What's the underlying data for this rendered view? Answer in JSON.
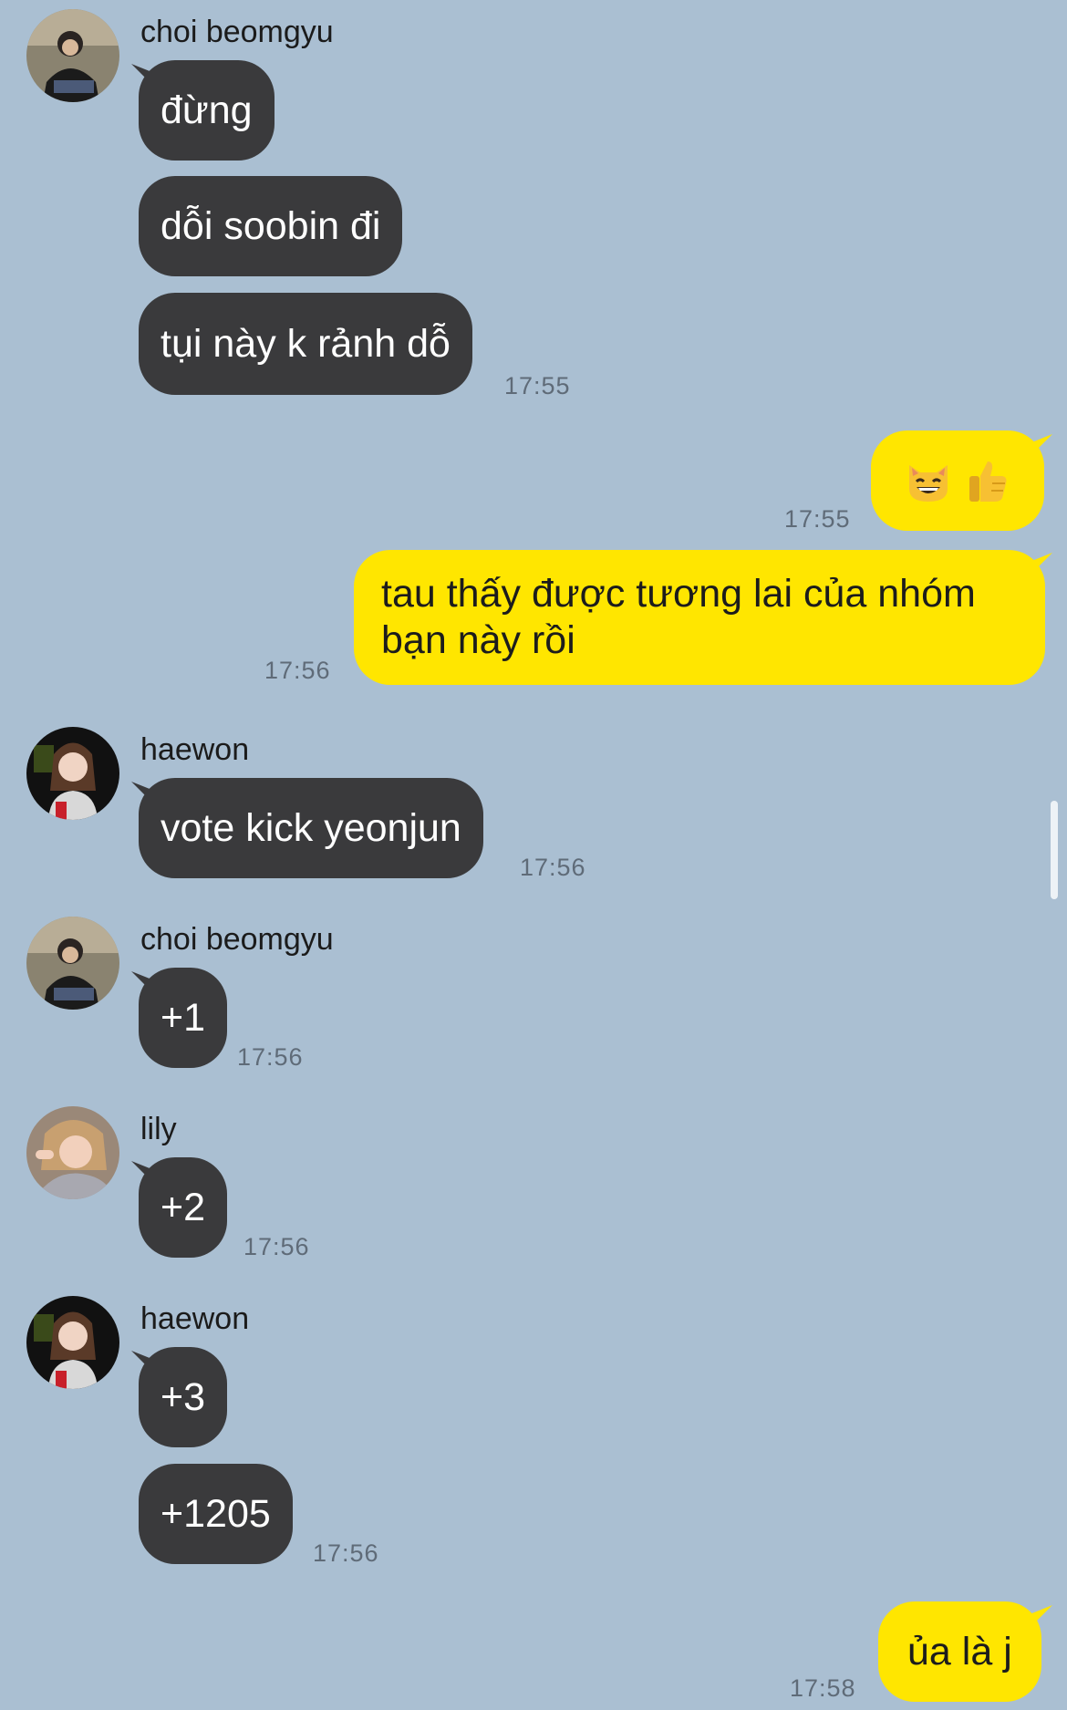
{
  "messages": [
    {
      "sender": "choi beomgyu",
      "texts": [
        "đừng",
        "dỗi soobin đi",
        "tụi này k rảnh dỗ"
      ],
      "time": "17:55"
    },
    {
      "outgoing": true,
      "emoji": [
        "grinning-cat-emoji",
        "thumbs-up-emoji"
      ],
      "time": "17:55"
    },
    {
      "outgoing": true,
      "text": "tau thấy được tương lai của nhóm bạn này rồi",
      "time": "17:56"
    },
    {
      "sender": "haewon",
      "texts": [
        "vote kick yeonjun"
      ],
      "time": "17:56"
    },
    {
      "sender": "choi beomgyu",
      "texts": [
        "+1"
      ],
      "time": "17:56"
    },
    {
      "sender": "lily",
      "texts": [
        "+2"
      ],
      "time": "17:56"
    },
    {
      "sender": "haewon",
      "texts": [
        "+3",
        "+1205"
      ],
      "time": "17:56"
    },
    {
      "outgoing": true,
      "text": "ủa là j",
      "time": "17:58"
    }
  ],
  "colors": {
    "background": "#aabfd2",
    "incoming_bubble": "#3a3a3c",
    "outgoing_bubble": "#ffe600",
    "timestamp": "#5f6b78"
  }
}
